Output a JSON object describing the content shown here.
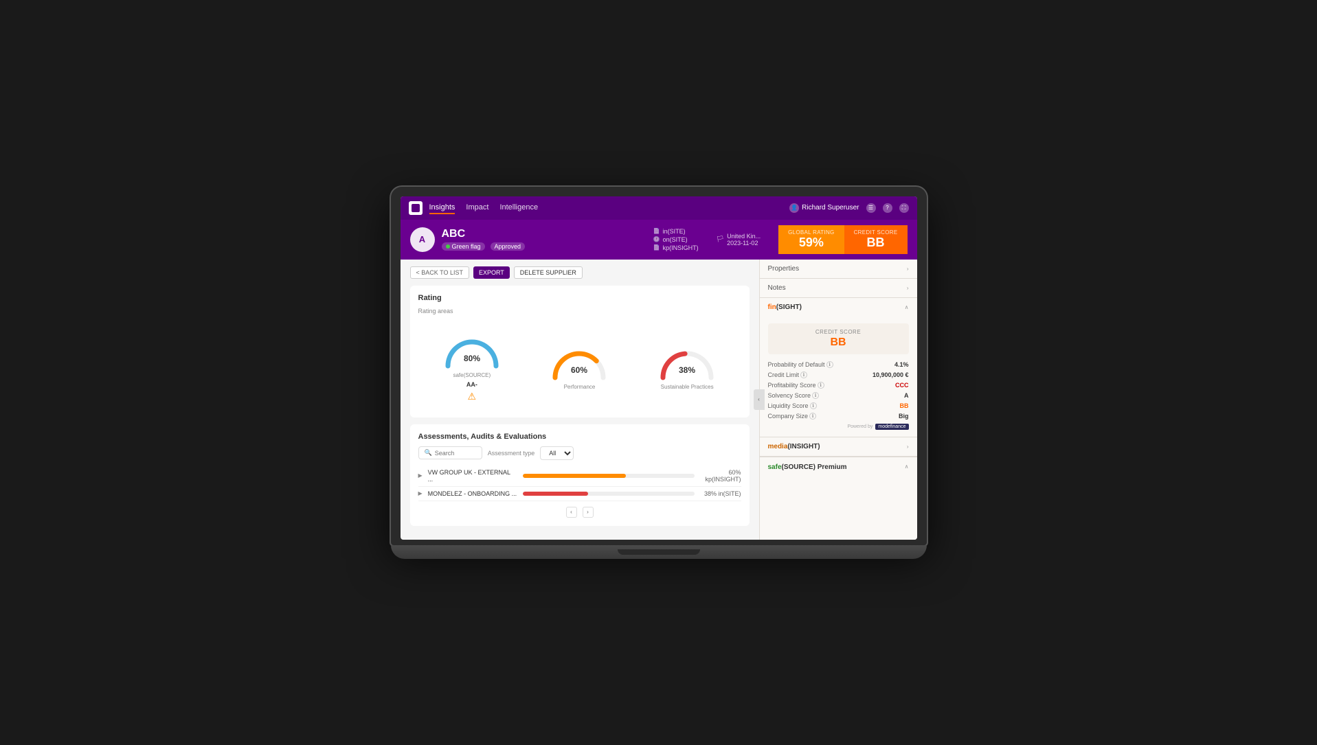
{
  "nav": {
    "links": [
      "Insights",
      "Impact",
      "Intelligence"
    ],
    "active_link": "Insights",
    "user": "Richard Superuser"
  },
  "supplier": {
    "name": "ABC",
    "initials": "A",
    "flag": "Green flag",
    "status": "Approved",
    "meta": {
      "in_site": "in(SITE)",
      "on_site": "on(SITE)",
      "kp_insight": "kp(INSIGHT)"
    },
    "country": "United Kin...",
    "date": "2023-11-02"
  },
  "scores": {
    "global_label": "GLOBAL RATING",
    "global_value": "59%",
    "credit_label": "CREDIT SCORE",
    "credit_value": "BB"
  },
  "actions": {
    "back": "< BACK TO LIST",
    "export": "EXPORT",
    "delete": "DELETE SUPPLIER"
  },
  "rating": {
    "title": "Rating",
    "subtitle": "Rating areas",
    "gauges": [
      {
        "value": "80%",
        "label": "safe(SOURCE)",
        "sublabel": "AA-",
        "color": "#4ab0e0",
        "pct": 80,
        "warning": true
      },
      {
        "value": "60%",
        "label": "Performance",
        "sublabel": "",
        "color": "#ff8c00",
        "pct": 60,
        "warning": false
      },
      {
        "value": "38%",
        "label": "Sustainable Practices",
        "sublabel": "",
        "color": "#e04040",
        "pct": 38,
        "warning": false
      }
    ]
  },
  "assessments": {
    "title": "Assessments, Audits & Evaluations",
    "filter_label": "Assessment type",
    "search_placeholder": "Search",
    "type_default": "All",
    "rows": [
      {
        "name": "VW GROUP UK - EXTERNAL ...",
        "progress": 60,
        "color": "#ff8c00",
        "label": "60% kp(INSIGHT)"
      },
      {
        "name": "MONDELEZ - ONBOARDING ...",
        "progress": 38,
        "color": "#e04040",
        "label": "38% in(SITE)"
      }
    ]
  },
  "right_panel": {
    "properties_label": "Properties",
    "notes_label": "Notes",
    "finsight": {
      "title_fin": "fin",
      "title_sight": "(SIGHT)",
      "credit_score_label": "CREDIT SCORE",
      "credit_score_value": "BB",
      "metrics": [
        {
          "label": "Probability of Default",
          "value": "4.1%"
        },
        {
          "label": "Credit Limit",
          "value": "10,900,000 €"
        },
        {
          "label": "Profitability Score",
          "value": "CCC"
        },
        {
          "label": "Solvency Score",
          "value": "A"
        },
        {
          "label": "Liquidity Score",
          "value": "BB"
        },
        {
          "label": "Company Size",
          "value": "Big"
        }
      ],
      "powered_by": "Powered by",
      "provider": "modefinance"
    },
    "media": {
      "title_media": "media",
      "title_insight": "(INSIGHT)"
    },
    "safe": {
      "title_safe": "safe",
      "title_source": "(SOURCE) Premium"
    }
  }
}
